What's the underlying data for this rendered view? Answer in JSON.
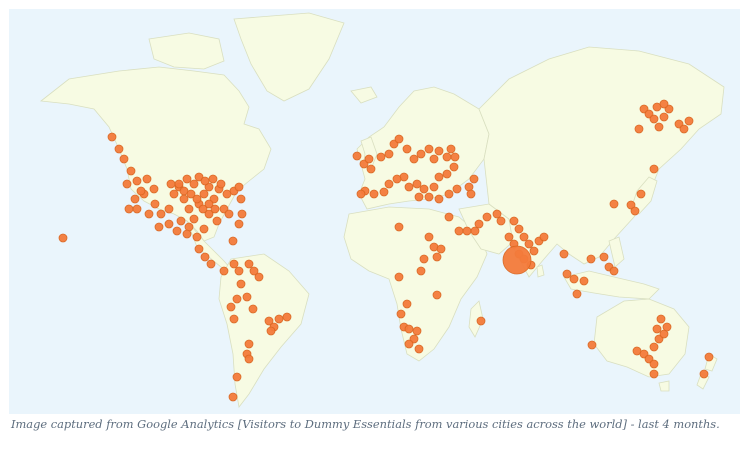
{
  "caption": "Image captured from Google Analytics [Visitors to Dummy Essentials from various cities across the world] - last 4 months.",
  "colors": {
    "ocean": "#eaf5fc",
    "land": "#f7fbe3",
    "border": "#d9dfc0",
    "marker": "#f47b3b",
    "caption_text": "#5d6d7e"
  },
  "map": {
    "type": "world visitor map",
    "marker_style": "orange circles per visiting city",
    "highlight_region": "India (largest marker)"
  }
}
